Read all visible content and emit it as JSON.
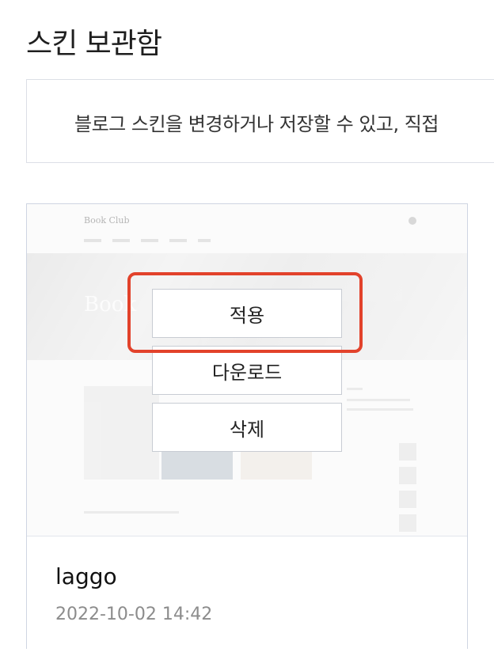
{
  "header": {
    "title": "스킨 보관함"
  },
  "info": {
    "text": "블로그 스킨을 변경하거나 저장할 수 있고, 직접"
  },
  "skin_card": {
    "preview": {
      "logo": "Book Club",
      "hero_text": "Book"
    },
    "actions": {
      "apply_label": "적용",
      "download_label": "다운로드",
      "delete_label": "삭제"
    },
    "name": "laggo",
    "date": "2022-10-02 14:42"
  },
  "colors": {
    "highlight": "#e2422b",
    "border": "#cfd5e2",
    "date_text": "#8c8c8c"
  },
  "icons": {
    "theme_toggle": "circle-dot-icon"
  }
}
